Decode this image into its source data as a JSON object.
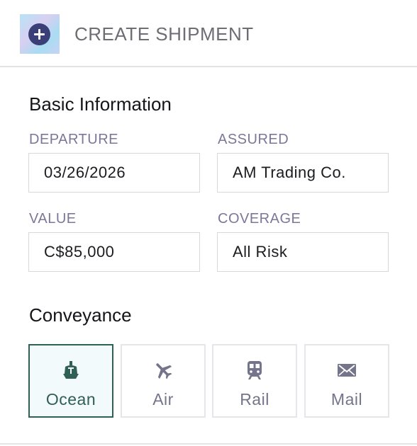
{
  "header": {
    "title": "CREATE SHIPMENT",
    "icon": "plus-circle-icon"
  },
  "basic_info": {
    "title": "Basic Information",
    "departure": {
      "label": "DEPARTURE",
      "value": "03/26/2026"
    },
    "assured": {
      "label": "ASSURED",
      "value": "AM Trading Co."
    },
    "value": {
      "label": "VALUE",
      "value": "C$85,000"
    },
    "coverage": {
      "label": "COVERAGE",
      "value": "All Risk"
    }
  },
  "conveyance": {
    "title": "Conveyance",
    "selected": "Ocean",
    "options": [
      {
        "label": "Ocean",
        "icon": "ship-icon"
      },
      {
        "label": "Air",
        "icon": "plane-icon"
      },
      {
        "label": "Rail",
        "icon": "train-icon"
      },
      {
        "label": "Mail",
        "icon": "envelope-icon"
      }
    ]
  },
  "colors": {
    "accent": "#2f5f55",
    "label": "#7a779a",
    "header_icon": "#3a3f77"
  }
}
